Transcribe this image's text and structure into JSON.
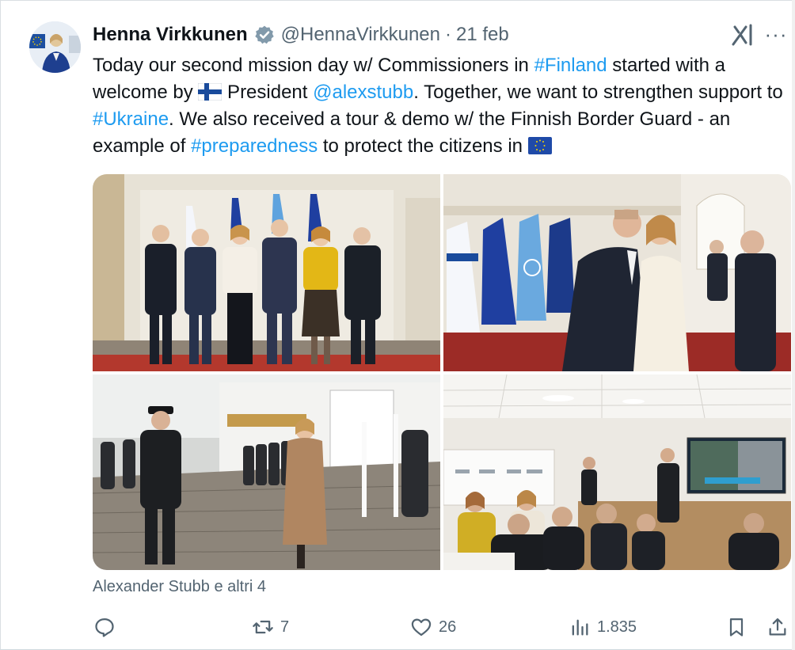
{
  "tweet": {
    "author_name": "Henna Virkkunen",
    "handle": "@HennaVirkkunen",
    "separator": "·",
    "date": "21 feb",
    "more_label": "···",
    "text": {
      "p1": "Today our second mission day w/ Commissioners in ",
      "tag_finland": "#Finland",
      "p2": " started with a welcome by ",
      "p3": " President ",
      "mention": "@alexstubb",
      "p4": ". Together, we want to strengthen support to ",
      "tag_ukraine": "#Ukraine",
      "p5": ". We also received a tour & demo w/ the Finnish Border Guard - an example of ",
      "tag_preparedness": "#preparedness",
      "p6": " to protect the citizens in "
    },
    "liked_by": "Alexander Stubb e altri 4"
  },
  "actions": {
    "reply_count": "",
    "repost_count": "7",
    "like_count": "26",
    "views_count": "1.835"
  },
  "icons": {
    "verified": "verified-badge-icon",
    "grok": "grok-icon",
    "reply": "reply-icon",
    "repost": "repost-icon",
    "like": "heart-icon",
    "views": "analytics-icon",
    "bookmark": "bookmark-icon",
    "share": "share-icon"
  },
  "colors": {
    "link": "#1d9bf0",
    "text": "#0f1419",
    "muted": "#536471"
  }
}
